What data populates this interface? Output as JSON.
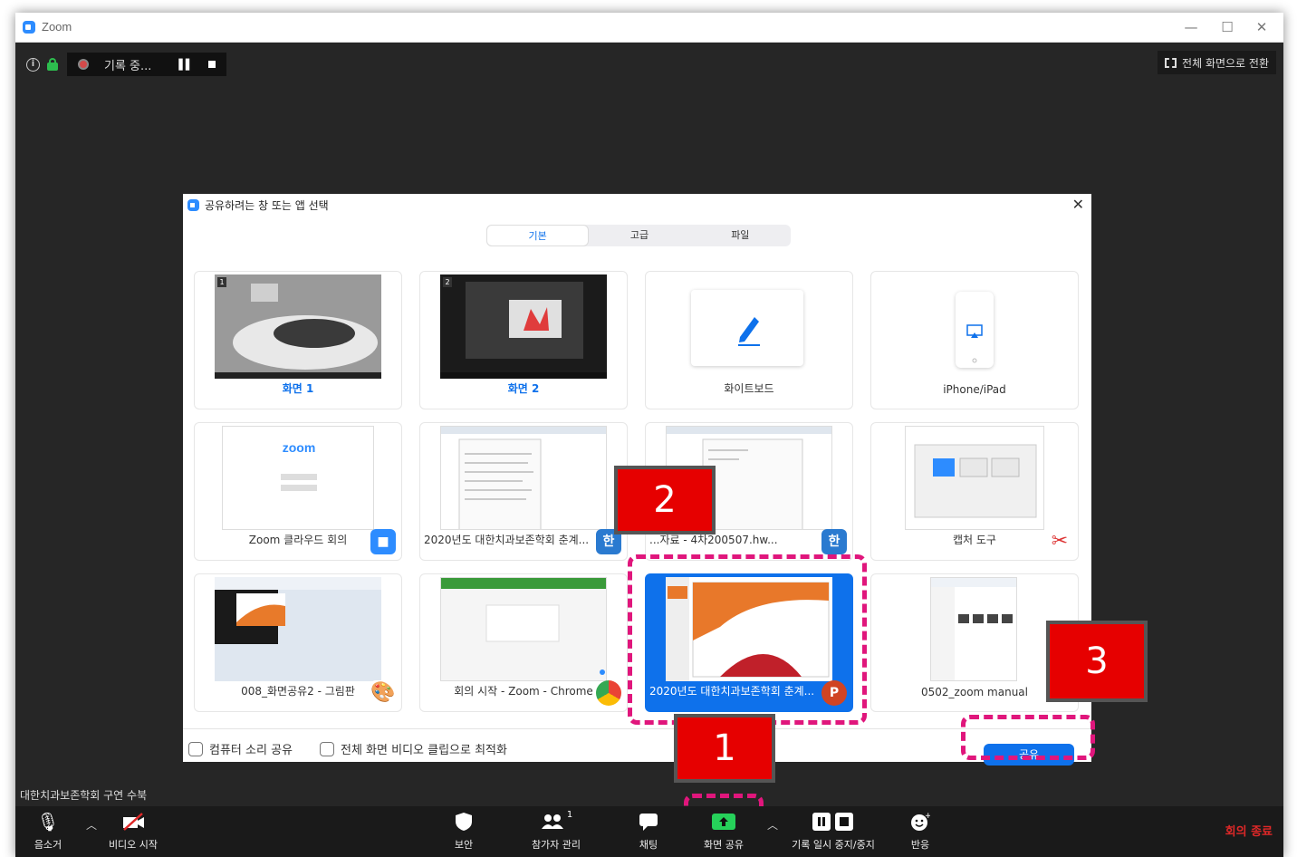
{
  "window": {
    "title": "Zoom"
  },
  "topbar": {
    "recording_text": "기록 중...",
    "fullscreen_label": "전체 화면으로 전환"
  },
  "dialog": {
    "title": "공유하려는 창 또는 앱 선택",
    "tabs": [
      "기본",
      "고급",
      "파일"
    ],
    "active_tab": "기본",
    "tiles": [
      {
        "label": "화면 1",
        "badge": "1"
      },
      {
        "label": "화면 2",
        "badge": "2"
      },
      {
        "label": "화이트보드"
      },
      {
        "label": "iPhone/iPad"
      },
      {
        "label": "Zoom 클라우드 회의",
        "app_icon": "zoom-app-icon"
      },
      {
        "label": "2020년도 대한치과보존학회 춘계...",
        "app_icon": "hwp-app-icon"
      },
      {
        "label": "...자료 - 4차200507.hw...",
        "app_icon": "hwp-app-icon"
      },
      {
        "label": "캡처 도구",
        "app_icon": "snipping-tool-icon"
      },
      {
        "label": "008_화면공유2 - 그림판",
        "app_icon": "paint-app-icon"
      },
      {
        "label": "회의 시작 - Zoom - Chrome",
        "app_icon": "chrome-app-icon"
      },
      {
        "label": "2020년도 대한치과보존학회 춘계...",
        "app_icon": "powerpoint-app-icon",
        "selected": true
      },
      {
        "label": "0502_zoom manual",
        "app_icon": "folder-app-icon"
      }
    ],
    "checkbox_audio": "컴퓨터 소리 공유",
    "checkbox_video": "전체 화면 비디오 클립으로 최적화",
    "share_button": "공유"
  },
  "callouts": [
    "1",
    "2",
    "3"
  ],
  "meeting_name": "대한치과보존학회 구연 수북",
  "toolbar": {
    "mute": "음소거",
    "video": "비디오 시작",
    "security": "보안",
    "participants": "참가자 관리",
    "participants_count": "1",
    "chat": "채팅",
    "share": "화면 공유",
    "record": "기록 일시 중지/중지",
    "reactions": "반응",
    "end": "회의 종료"
  },
  "colors": {
    "accent": "#0e71eb",
    "highlight": "#e0167c",
    "callout": "#e60000",
    "share_green": "#26d15a",
    "end_red": "#e02828"
  }
}
